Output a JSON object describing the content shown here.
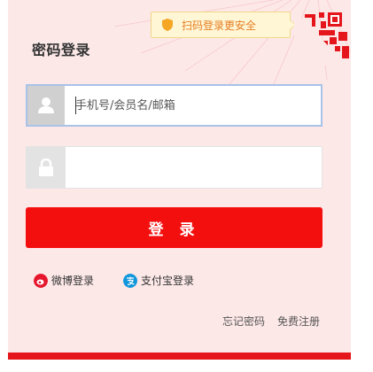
{
  "login": {
    "title": "密码登录",
    "qr_tip": "扫码登录更安全",
    "username": {
      "placeholder": "手机号/会员名/邮箱",
      "value": ""
    },
    "password": {
      "placeholder": "",
      "value": ""
    },
    "submit_label": "登 录",
    "social": [
      {
        "label": "微博登录",
        "icon": "weibo-icon",
        "color": "#e6162d"
      },
      {
        "label": "支付宝登录",
        "icon": "alipay-icon",
        "color": "#1296db"
      }
    ],
    "links": {
      "forgot": "忘记密码",
      "register": "免费注册"
    }
  },
  "colors": {
    "accent": "#f40f0f",
    "panel_bg": "#fde8e8",
    "tip_text": "#e67e22"
  }
}
